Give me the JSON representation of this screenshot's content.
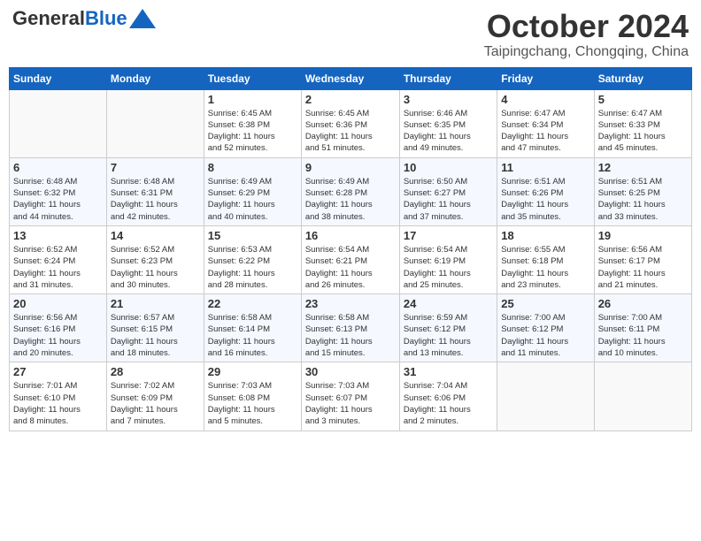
{
  "header": {
    "logo_general": "General",
    "logo_blue": "Blue",
    "month": "October 2024",
    "location": "Taipingchang, Chongqing, China"
  },
  "columns": [
    "Sunday",
    "Monday",
    "Tuesday",
    "Wednesday",
    "Thursday",
    "Friday",
    "Saturday"
  ],
  "weeks": [
    [
      {
        "day": "",
        "info": ""
      },
      {
        "day": "",
        "info": ""
      },
      {
        "day": "1",
        "info": "Sunrise: 6:45 AM\nSunset: 6:38 PM\nDaylight: 11 hours\nand 52 minutes."
      },
      {
        "day": "2",
        "info": "Sunrise: 6:45 AM\nSunset: 6:36 PM\nDaylight: 11 hours\nand 51 minutes."
      },
      {
        "day": "3",
        "info": "Sunrise: 6:46 AM\nSunset: 6:35 PM\nDaylight: 11 hours\nand 49 minutes."
      },
      {
        "day": "4",
        "info": "Sunrise: 6:47 AM\nSunset: 6:34 PM\nDaylight: 11 hours\nand 47 minutes."
      },
      {
        "day": "5",
        "info": "Sunrise: 6:47 AM\nSunset: 6:33 PM\nDaylight: 11 hours\nand 45 minutes."
      }
    ],
    [
      {
        "day": "6",
        "info": "Sunrise: 6:48 AM\nSunset: 6:32 PM\nDaylight: 11 hours\nand 44 minutes."
      },
      {
        "day": "7",
        "info": "Sunrise: 6:48 AM\nSunset: 6:31 PM\nDaylight: 11 hours\nand 42 minutes."
      },
      {
        "day": "8",
        "info": "Sunrise: 6:49 AM\nSunset: 6:29 PM\nDaylight: 11 hours\nand 40 minutes."
      },
      {
        "day": "9",
        "info": "Sunrise: 6:49 AM\nSunset: 6:28 PM\nDaylight: 11 hours\nand 38 minutes."
      },
      {
        "day": "10",
        "info": "Sunrise: 6:50 AM\nSunset: 6:27 PM\nDaylight: 11 hours\nand 37 minutes."
      },
      {
        "day": "11",
        "info": "Sunrise: 6:51 AM\nSunset: 6:26 PM\nDaylight: 11 hours\nand 35 minutes."
      },
      {
        "day": "12",
        "info": "Sunrise: 6:51 AM\nSunset: 6:25 PM\nDaylight: 11 hours\nand 33 minutes."
      }
    ],
    [
      {
        "day": "13",
        "info": "Sunrise: 6:52 AM\nSunset: 6:24 PM\nDaylight: 11 hours\nand 31 minutes."
      },
      {
        "day": "14",
        "info": "Sunrise: 6:52 AM\nSunset: 6:23 PM\nDaylight: 11 hours\nand 30 minutes."
      },
      {
        "day": "15",
        "info": "Sunrise: 6:53 AM\nSunset: 6:22 PM\nDaylight: 11 hours\nand 28 minutes."
      },
      {
        "day": "16",
        "info": "Sunrise: 6:54 AM\nSunset: 6:21 PM\nDaylight: 11 hours\nand 26 minutes."
      },
      {
        "day": "17",
        "info": "Sunrise: 6:54 AM\nSunset: 6:19 PM\nDaylight: 11 hours\nand 25 minutes."
      },
      {
        "day": "18",
        "info": "Sunrise: 6:55 AM\nSunset: 6:18 PM\nDaylight: 11 hours\nand 23 minutes."
      },
      {
        "day": "19",
        "info": "Sunrise: 6:56 AM\nSunset: 6:17 PM\nDaylight: 11 hours\nand 21 minutes."
      }
    ],
    [
      {
        "day": "20",
        "info": "Sunrise: 6:56 AM\nSunset: 6:16 PM\nDaylight: 11 hours\nand 20 minutes."
      },
      {
        "day": "21",
        "info": "Sunrise: 6:57 AM\nSunset: 6:15 PM\nDaylight: 11 hours\nand 18 minutes."
      },
      {
        "day": "22",
        "info": "Sunrise: 6:58 AM\nSunset: 6:14 PM\nDaylight: 11 hours\nand 16 minutes."
      },
      {
        "day": "23",
        "info": "Sunrise: 6:58 AM\nSunset: 6:13 PM\nDaylight: 11 hours\nand 15 minutes."
      },
      {
        "day": "24",
        "info": "Sunrise: 6:59 AM\nSunset: 6:12 PM\nDaylight: 11 hours\nand 13 minutes."
      },
      {
        "day": "25",
        "info": "Sunrise: 7:00 AM\nSunset: 6:12 PM\nDaylight: 11 hours\nand 11 minutes."
      },
      {
        "day": "26",
        "info": "Sunrise: 7:00 AM\nSunset: 6:11 PM\nDaylight: 11 hours\nand 10 minutes."
      }
    ],
    [
      {
        "day": "27",
        "info": "Sunrise: 7:01 AM\nSunset: 6:10 PM\nDaylight: 11 hours\nand 8 minutes."
      },
      {
        "day": "28",
        "info": "Sunrise: 7:02 AM\nSunset: 6:09 PM\nDaylight: 11 hours\nand 7 minutes."
      },
      {
        "day": "29",
        "info": "Sunrise: 7:03 AM\nSunset: 6:08 PM\nDaylight: 11 hours\nand 5 minutes."
      },
      {
        "day": "30",
        "info": "Sunrise: 7:03 AM\nSunset: 6:07 PM\nDaylight: 11 hours\nand 3 minutes."
      },
      {
        "day": "31",
        "info": "Sunrise: 7:04 AM\nSunset: 6:06 PM\nDaylight: 11 hours\nand 2 minutes."
      },
      {
        "day": "",
        "info": ""
      },
      {
        "day": "",
        "info": ""
      }
    ]
  ]
}
